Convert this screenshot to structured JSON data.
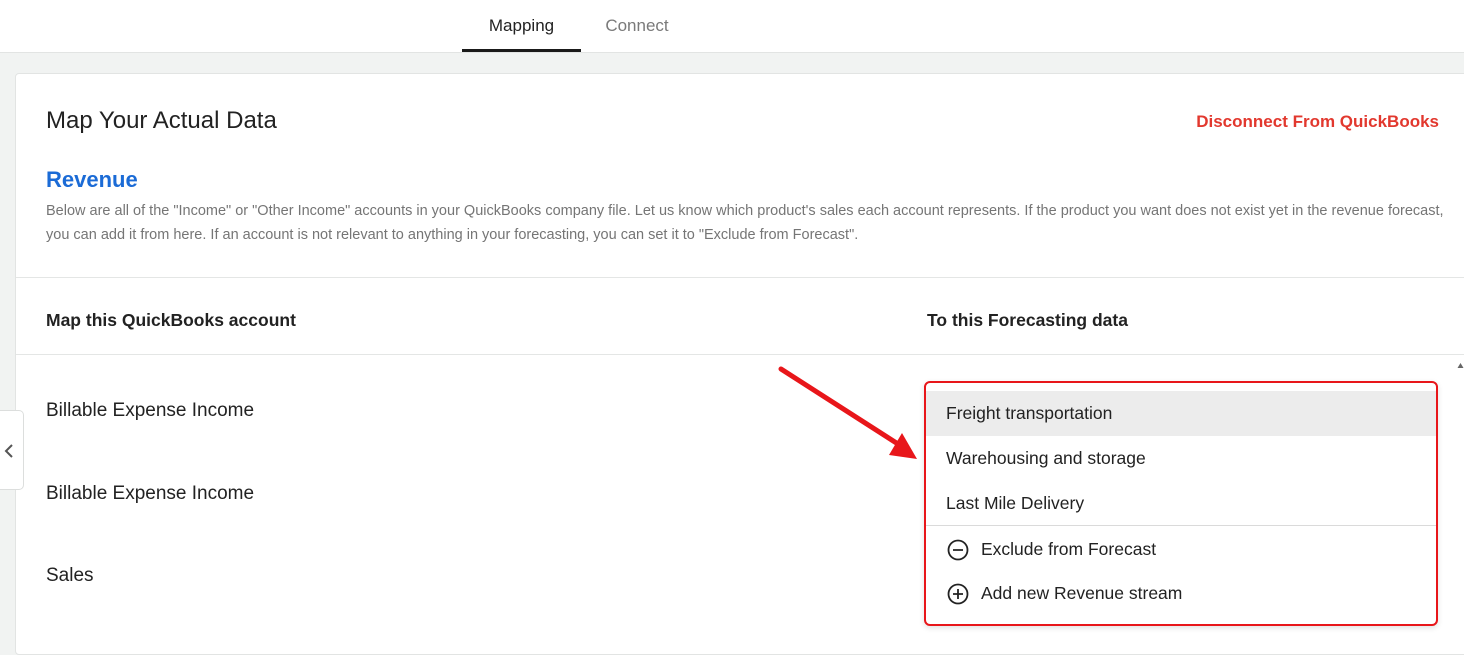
{
  "tabs": [
    {
      "label": "Mapping",
      "active": true
    },
    {
      "label": "Connect",
      "active": false
    }
  ],
  "page": {
    "title": "Map Your Actual Data",
    "disconnect_label": "Disconnect From QuickBooks"
  },
  "section": {
    "title": "Revenue",
    "description": "Below are all of the \"Income\" or \"Other Income\" accounts in your QuickBooks company file. Let us know which product's sales each account represents. If the product you want does not exist yet in the revenue forecast, you can add it from here. If an account is not relevant to anything in your forecasting, you can set it to \"Exclude from Forecast\"."
  },
  "table": {
    "col_left": "Map this QuickBooks account",
    "col_right": "To this Forecasting data",
    "rows": [
      {
        "account": "Billable Expense Income"
      },
      {
        "account": "Billable Expense Income"
      },
      {
        "account": "Sales"
      }
    ]
  },
  "dropdown": {
    "options": [
      {
        "label": "Freight transportation",
        "selected": true
      },
      {
        "label": "Warehousing and storage",
        "selected": false
      },
      {
        "label": "Last Mile Delivery",
        "selected": false
      }
    ],
    "actions": [
      {
        "label": "Exclude from Forecast",
        "icon": "minus-circle-icon"
      },
      {
        "label": "Add new Revenue stream",
        "icon": "plus-circle-icon"
      }
    ]
  },
  "colors": {
    "accent_blue": "#1b6bd6",
    "danger_red": "#e2382e",
    "annotation_red": "#e8161a"
  }
}
